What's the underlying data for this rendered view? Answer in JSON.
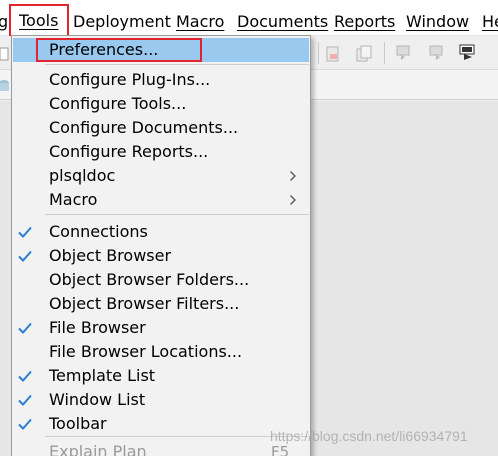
{
  "menubar": {
    "items": [
      {
        "label": "g"
      },
      {
        "label": "Tools"
      },
      {
        "label": "Deployment"
      },
      {
        "label": "Macro"
      },
      {
        "label": "Documents"
      },
      {
        "label": "Reports"
      },
      {
        "label": "Window"
      },
      {
        "label": "He"
      }
    ]
  },
  "tools_menu": {
    "items": [
      {
        "label": "Preferences...",
        "checked": false,
        "submenu": false,
        "highlighted": true
      },
      {
        "label": "Configure Plug-Ins...",
        "checked": false,
        "submenu": false
      },
      {
        "label": "Configure Tools...",
        "checked": false,
        "submenu": false
      },
      {
        "label": "Configure Documents...",
        "checked": false,
        "submenu": false
      },
      {
        "label": "Configure Reports...",
        "checked": false,
        "submenu": false
      },
      {
        "label": "plsqldoc",
        "checked": false,
        "submenu": true
      },
      {
        "label": "Macro",
        "checked": false,
        "submenu": true
      },
      {
        "label": "Connections",
        "checked": true,
        "submenu": false
      },
      {
        "label": "Object Browser",
        "checked": true,
        "submenu": false
      },
      {
        "label": "Object Browser Folders...",
        "checked": false,
        "submenu": false
      },
      {
        "label": "Object Browser Filters...",
        "checked": false,
        "submenu": false
      },
      {
        "label": "File Browser",
        "checked": true,
        "submenu": false
      },
      {
        "label": "File Browser Locations...",
        "checked": false,
        "submenu": false
      },
      {
        "label": "Template List",
        "checked": true,
        "submenu": false
      },
      {
        "label": "Window List",
        "checked": true,
        "submenu": false
      },
      {
        "label": "Toolbar",
        "checked": true,
        "submenu": false
      },
      {
        "label": "Explain Plan",
        "checked": false,
        "submenu": false,
        "disabled": true,
        "shortcut": "F5"
      }
    ]
  },
  "colors": {
    "highlight": "#99c9ef",
    "callout_red": "#e0232d",
    "check_blue": "#2a7fd4",
    "disabled_text": "#9a9a9a"
  },
  "watermark": "https://blog.csdn.net/li66934791"
}
